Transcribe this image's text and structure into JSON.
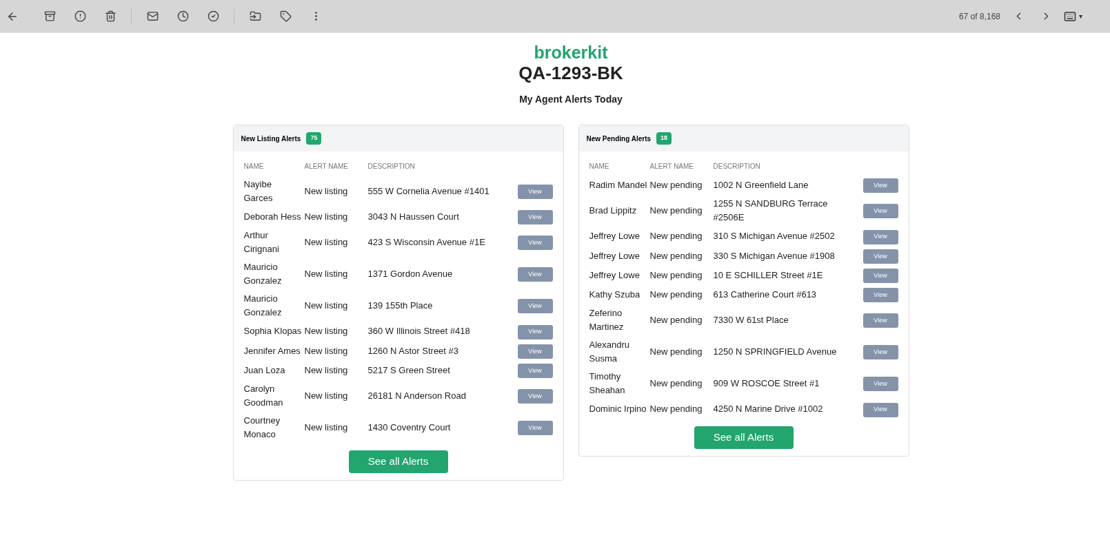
{
  "toolbar": {
    "counter": "67 of 8,168",
    "menu_caret": "▾"
  },
  "logo": "brokerkit",
  "title": "QA-1293-BK",
  "subtitle": "My Agent Alerts Today",
  "panels": [
    {
      "title": "New Listing Alerts",
      "count": "75",
      "columns": [
        "NAME",
        "ALERT NAME",
        "DESCRIPTION"
      ],
      "button": "See all Alerts",
      "rows": [
        {
          "name": "Nayibe Garces",
          "alert": "New listing",
          "description": "555 W Cornelia Avenue #1401",
          "action": "View"
        },
        {
          "name": "Deborah Hess",
          "alert": "New listing",
          "description": "3043 N Haussen Court",
          "action": "View"
        },
        {
          "name": "Arthur Cirignani",
          "alert": "New listing",
          "description": "423 S Wisconsin Avenue #1E",
          "action": "View"
        },
        {
          "name": "Mauricio Gonzalez",
          "alert": "New listing",
          "description": "1371 Gordon Avenue",
          "action": "View"
        },
        {
          "name": "Mauricio Gonzalez",
          "alert": "New listing",
          "description": "139 155th Place",
          "action": "View"
        },
        {
          "name": "Sophia Klopas",
          "alert": "New listing",
          "description": "360 W Illinois Street #418",
          "action": "View"
        },
        {
          "name": "Jennifer Ames",
          "alert": "New listing",
          "description": "1260 N Astor Street #3",
          "action": "View"
        },
        {
          "name": "Juan Loza",
          "alert": "New listing",
          "description": "5217 S Green Street",
          "action": "View"
        },
        {
          "name": "Carolyn Goodman",
          "alert": "New listing",
          "description": "26181 N Anderson Road",
          "action": "View"
        },
        {
          "name": "Courtney Monaco",
          "alert": "New listing",
          "description": "1430 Coventry Court",
          "action": "View"
        }
      ]
    },
    {
      "title": "New Pending Alerts",
      "count": "18",
      "columns": [
        "NAME",
        "ALERT NAME",
        "DESCRIPTION"
      ],
      "button": "See all Alerts",
      "rows": [
        {
          "name": "Radim Mandel",
          "alert": "New pending",
          "description": "1002 N Greenfield Lane",
          "action": "View"
        },
        {
          "name": "Brad Lippitz",
          "alert": "New pending",
          "description": "1255 N SANDBURG Terrace #2506E",
          "action": "View"
        },
        {
          "name": "Jeffrey Lowe",
          "alert": "New pending",
          "description": "310 S Michigan Avenue #2502",
          "action": "View"
        },
        {
          "name": "Jeffrey Lowe",
          "alert": "New pending",
          "description": "330 S Michigan Avenue #1908",
          "action": "View"
        },
        {
          "name": "Jeffrey Lowe",
          "alert": "New pending",
          "description": "10 E SCHILLER Street #1E",
          "action": "View"
        },
        {
          "name": "Kathy Szuba",
          "alert": "New pending",
          "description": "613 Catherine Court #613",
          "action": "View"
        },
        {
          "name": "Zeferino Martinez",
          "alert": "New pending",
          "description": "7330 W 61st Place",
          "action": "View"
        },
        {
          "name": "Alexandru Susma",
          "alert": "New pending",
          "description": "1250 N SPRINGFIELD Avenue",
          "action": "View"
        },
        {
          "name": "Timothy Sheahan",
          "alert": "New pending",
          "description": "909 W ROSCOE Street #1",
          "action": "View"
        },
        {
          "name": "Dominic Irpino",
          "alert": "New pending",
          "description": "4250 N Marine Drive #1002",
          "action": "View"
        }
      ]
    }
  ]
}
